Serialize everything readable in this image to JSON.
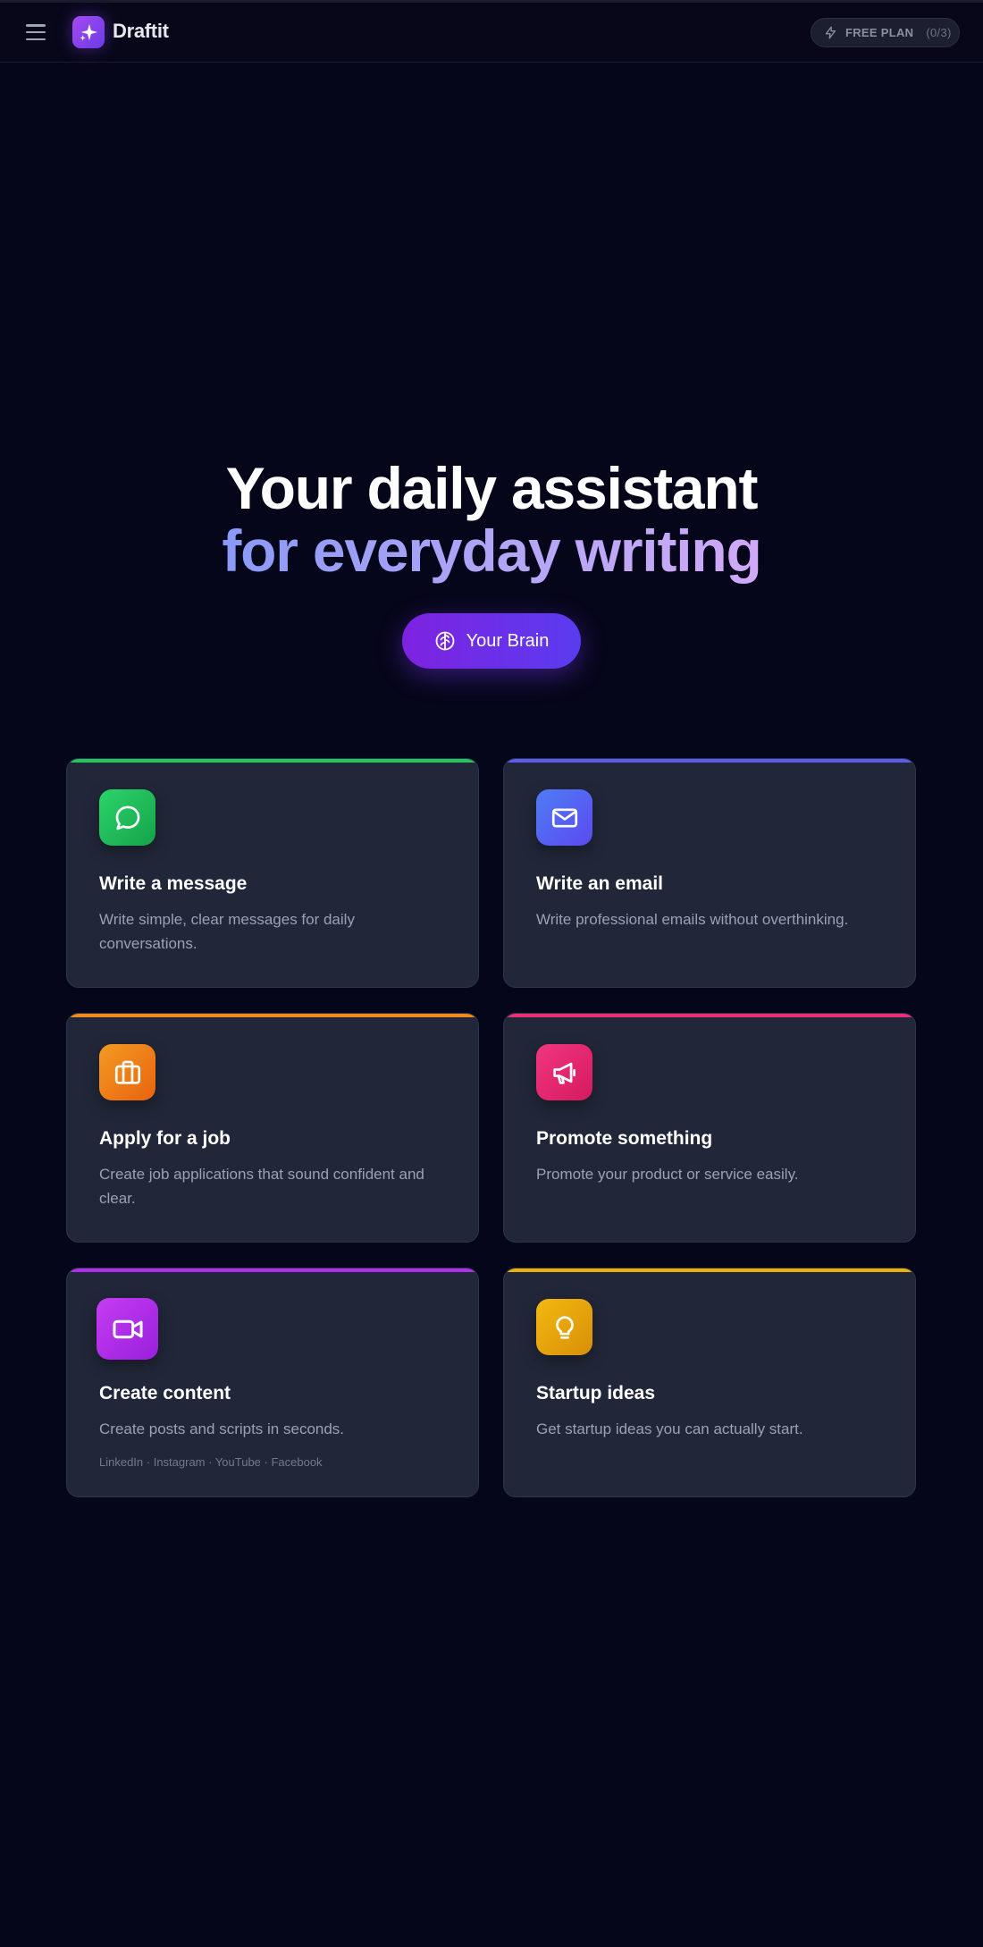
{
  "app": {
    "brand": "Draftit",
    "plan_label": "FREE PLAN",
    "plan_count": "(0/3)"
  },
  "hero": {
    "line1": "Your daily assistant",
    "line2": "for everyday writing",
    "button_label": "Your Brain"
  },
  "cards": [
    {
      "title": "Write a message",
      "description": "Write simple, clear messages for daily conversations.",
      "icon": "chat-bubble-icon",
      "accent": "#22c55e"
    },
    {
      "title": "Write an email",
      "description": "Write professional emails without overthinking.",
      "icon": "envelope-icon",
      "accent": "#5a5cf0"
    },
    {
      "title": "Apply for a job",
      "description": "Create job applications that sound confident and clear.",
      "icon": "briefcase-icon",
      "accent": "#f08a1c"
    },
    {
      "title": "Promote something",
      "description": "Promote your product or service easily.",
      "icon": "megaphone-icon",
      "accent": "#ec2f7b"
    },
    {
      "title": "Create content",
      "description": "Create posts and scripts in seconds.",
      "tags": "LinkedIn · Instagram · YouTube · Facebook",
      "icon": "video-camera-icon",
      "accent": "#b32ef0"
    },
    {
      "title": "Startup ideas",
      "description": "Get startup ideas you can actually start.",
      "icon": "lightbulb-icon",
      "accent": "#eab10e"
    }
  ]
}
